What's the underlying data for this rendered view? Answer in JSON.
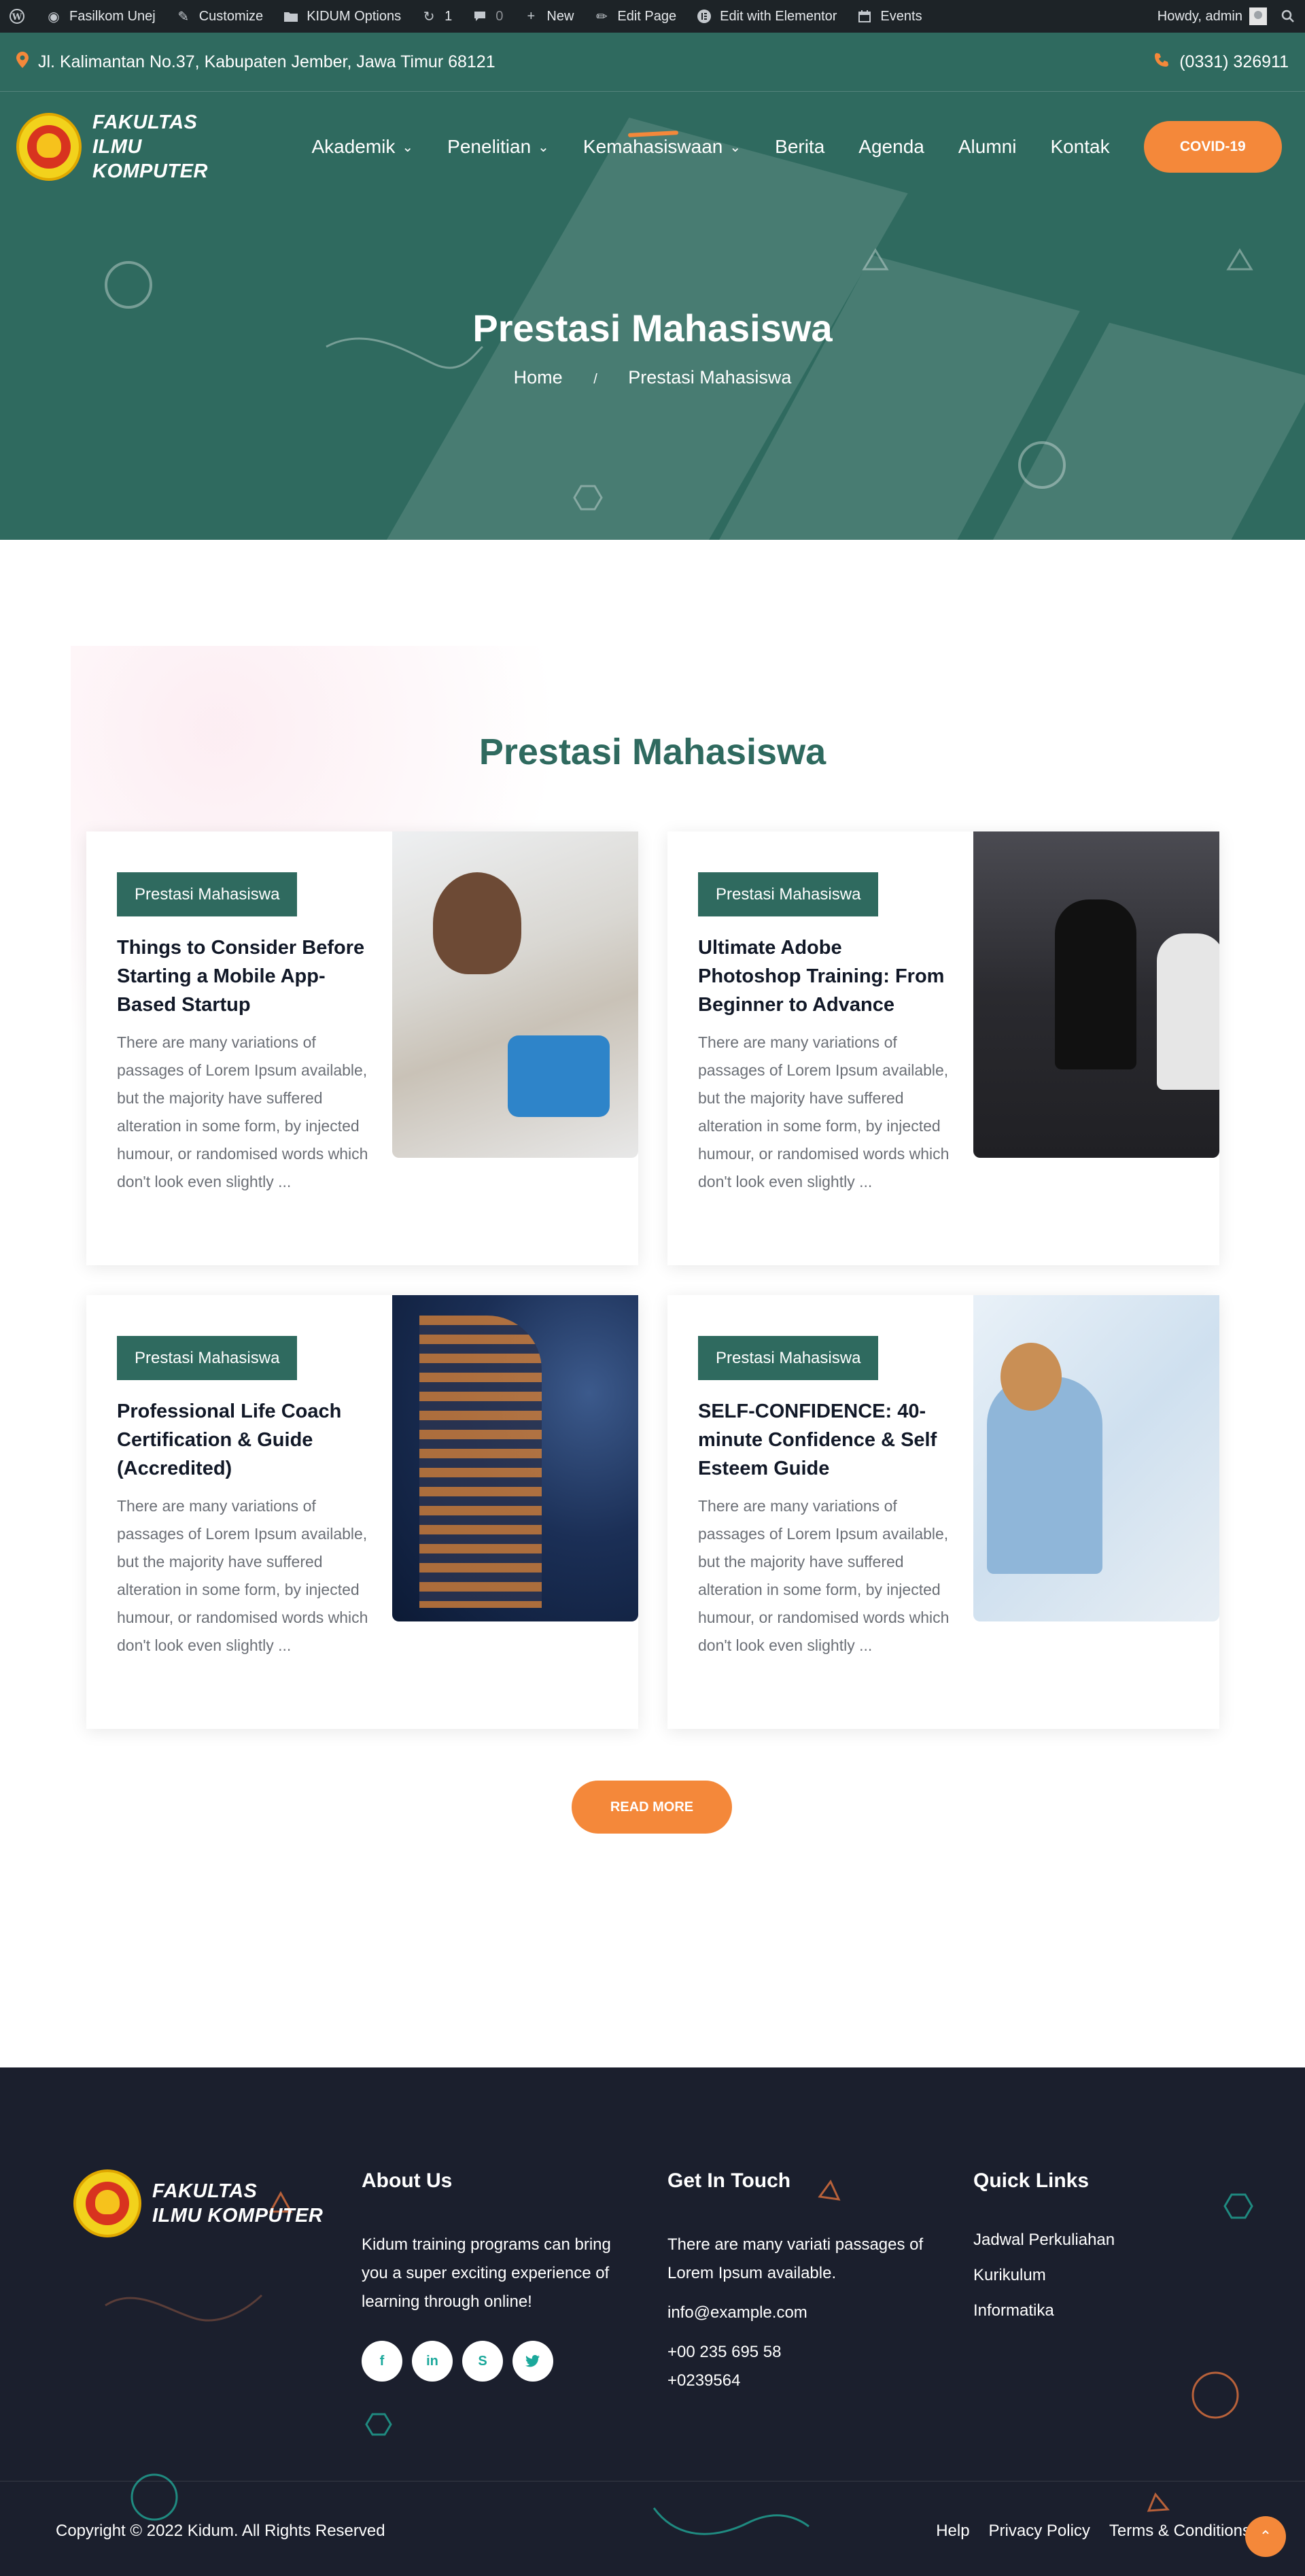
{
  "admin_bar": {
    "site_name": "Fasilkom Unej",
    "customize": "Customize",
    "theme_options": "KIDUM Options",
    "updates_count": "1",
    "comments_count": "0",
    "new": "New",
    "edit_page": "Edit Page",
    "elementor": "Edit with Elementor",
    "events": "Events",
    "howdy": "Howdy, admin"
  },
  "topbar": {
    "address": "Jl. Kalimantan No.37, Kabupaten Jember, Jawa Timur 68121",
    "phone": "(0331) 326911"
  },
  "logo": {
    "line1": "FAKULTAS",
    "line2": "ILMU KOMPUTER"
  },
  "nav": {
    "items": [
      {
        "label": "Akademik",
        "dropdown": true
      },
      {
        "label": "Penelitian",
        "dropdown": true
      },
      {
        "label": "Kemahasiswaan",
        "dropdown": true
      },
      {
        "label": "Berita",
        "dropdown": false
      },
      {
        "label": "Agenda",
        "dropdown": false
      },
      {
        "label": "Alumni",
        "dropdown": false
      },
      {
        "label": "Kontak",
        "dropdown": false
      }
    ],
    "cta": "COVID-19"
  },
  "hero": {
    "title": "Prestasi Mahasiswa",
    "breadcrumb_home": "Home",
    "breadcrumb_current": "Prestasi Mahasiswa"
  },
  "section": {
    "title": "Prestasi Mahasiswa"
  },
  "cards": [
    {
      "badge": "Prestasi Mahasiswa",
      "title": "Things to Consider Before Starting a Mobile App-Based Startup",
      "excerpt": "There are many variations of passages of Lorem Ipsum available, but the majority have suffered alteration in some form, by injected humour, or randomised words which don't look even slightly ..."
    },
    {
      "badge": "Prestasi Mahasiswa",
      "title": "Ultimate Adobe Photoshop Training: From Beginner to Advance",
      "excerpt": "There are many variations of passages of Lorem Ipsum available, but the majority have suffered alteration in some form, by injected humour, or randomised words which don't look even slightly ..."
    },
    {
      "badge": "Prestasi Mahasiswa",
      "title": "Professional Life Coach Certification & Guide (Accredited)",
      "excerpt": "There are many variations of passages of Lorem Ipsum available, but the majority have suffered alteration in some form, by injected humour, or randomised words which don't look even slightly ..."
    },
    {
      "badge": "Prestasi Mahasiswa",
      "title": "SELF-CONFIDENCE: 40-minute Confidence & Self Esteem Guide",
      "excerpt": "There are many variations of passages of Lorem Ipsum available, but the majority have suffered alteration in some form, by injected humour, or randomised words which don't look even slightly ..."
    }
  ],
  "read_more": "READ MORE",
  "footer": {
    "about_title": "About Us",
    "about_text": "Kidum training programs can bring you a super exciting experience of learning through online!",
    "contact_title": "Get In Touch",
    "contact_text": "There are many variati passages of Lorem Ipsum available.",
    "email": "info@example.com",
    "phone1": "+00 235 695 58",
    "phone2": "+0239564",
    "links_title": "Quick Links",
    "links": [
      "Jadwal Perkuliahan",
      "Kurikulum",
      "Informatika"
    ],
    "copyright": "Copyright © 2022 Kidum. All Rights Reserved",
    "bottom_links": [
      "Help",
      "Privacy Policy",
      "Terms & Conditions"
    ]
  },
  "colors": {
    "primary_green": "#2f6a5f",
    "accent_orange": "#f4883a",
    "footer_bg": "#1b1f2d",
    "admin_bar": "#1d2327"
  }
}
